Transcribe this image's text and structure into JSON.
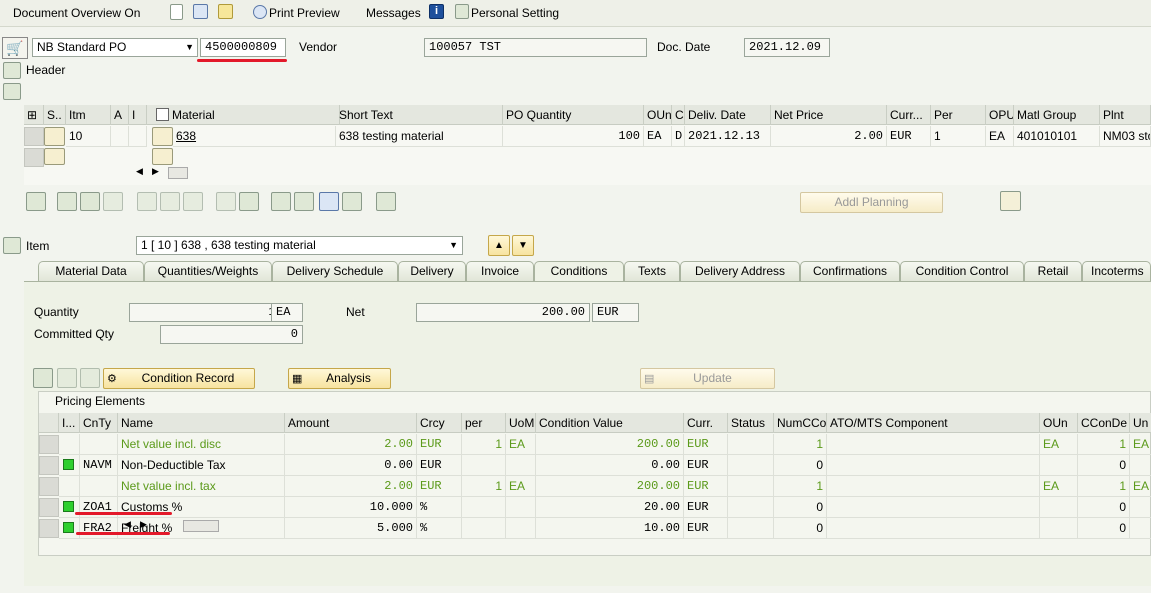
{
  "toolbar": {
    "doc_overview": "Document Overview On",
    "print_preview": "Print Preview",
    "messages": "Messages",
    "personal_setting": "Personal Setting"
  },
  "header": {
    "po_type": "NB Standard PO",
    "po_number": "4500000809",
    "vendor_label": "Vendor",
    "vendor_value": "100057 TST",
    "doc_date_label": "Doc. Date",
    "doc_date_value": "2021.12.09",
    "header_label": "Header"
  },
  "items_table": {
    "columns": [
      "S..",
      "Itm",
      "A",
      "I",
      "Material",
      "Short Text",
      "PO Quantity",
      "OUn",
      "C",
      "Deliv. Date",
      "Net Price",
      "Curr...",
      "Per",
      "OPU",
      "Matl Group",
      "Plnt"
    ],
    "rows": [
      {
        "itm": "10",
        "material": "638",
        "short_text": "638 testing material",
        "po_qty": "100",
        "oun": "EA",
        "c": "D",
        "deliv_date": "2021.12.13",
        "net_price": "2.00",
        "curr": "EUR",
        "per": "1",
        "opu": "EA",
        "matl_group": "401010101",
        "plnt": "NM03 sto"
      }
    ]
  },
  "addl_planning": "Addl Planning",
  "item_section": {
    "label": "Item",
    "selected": "1 [ 10 ] 638 , 638 testing material"
  },
  "tabs": [
    "Material Data",
    "Quantities/Weights",
    "Delivery Schedule",
    "Delivery",
    "Invoice",
    "Conditions",
    "Texts",
    "Delivery Address",
    "Confirmations",
    "Condition Control",
    "Retail",
    "Incoterms"
  ],
  "conditions": {
    "quantity_label": "Quantity",
    "quantity_value": "100",
    "quantity_unit": "EA",
    "net_label": "Net",
    "net_value": "200.00",
    "net_currency": "EUR",
    "committed_label": "Committed Qty",
    "committed_value": "0",
    "condition_record": "Condition Record",
    "analysis": "Analysis",
    "update": "Update",
    "pricing_title": "Pricing Elements"
  },
  "pricing_table": {
    "columns": [
      "I...",
      "CnTy",
      "Name",
      "Amount",
      "Crcy",
      "per",
      "UoM",
      "Condition Value",
      "Curr.",
      "Status",
      "NumCCo",
      "ATO/MTS Component",
      "OUn",
      "CConDe",
      "Un"
    ],
    "rows": [
      {
        "green": true,
        "status_icon": false,
        "cnty": "",
        "name": "Net value incl. disc",
        "amount": "2.00",
        "crcy": "EUR",
        "per": "1",
        "uom": "EA",
        "cond_value": "200.00",
        "curr": "EUR",
        "numcco": "1",
        "oun": "EA",
        "ccon": "1",
        "un": "EA"
      },
      {
        "green": false,
        "status_icon": true,
        "cnty": "NAVM",
        "name": "Non-Deductible Tax",
        "amount": "0.00",
        "crcy": "EUR",
        "per": "",
        "uom": "",
        "cond_value": "0.00",
        "curr": "EUR",
        "numcco": "0",
        "oun": "",
        "ccon": "0",
        "un": ""
      },
      {
        "green": true,
        "status_icon": false,
        "cnty": "",
        "name": "Net value incl. tax",
        "amount": "2.00",
        "crcy": "EUR",
        "per": "1",
        "uom": "EA",
        "cond_value": "200.00",
        "curr": "EUR",
        "numcco": "1",
        "oun": "EA",
        "ccon": "1",
        "un": "EA"
      },
      {
        "green": false,
        "status_icon": true,
        "cnty": "ZOA1",
        "name": "Customs %",
        "amount": "10.000",
        "crcy": "%",
        "per": "",
        "uom": "",
        "cond_value": "20.00",
        "curr": "EUR",
        "numcco": "0",
        "oun": "",
        "ccon": "0",
        "un": ""
      },
      {
        "green": false,
        "status_icon": true,
        "cnty": "FRA2",
        "name": "Freight %",
        "amount": "5.000",
        "crcy": "%",
        "per": "",
        "uom": "",
        "cond_value": "10.00",
        "curr": "EUR",
        "numcco": "0",
        "oun": "",
        "ccon": "0",
        "un": ""
      }
    ]
  },
  "colors": {
    "green_text": "#5b9a1a",
    "annotation_red": "#e3192a",
    "background": "#f2f4ee"
  }
}
